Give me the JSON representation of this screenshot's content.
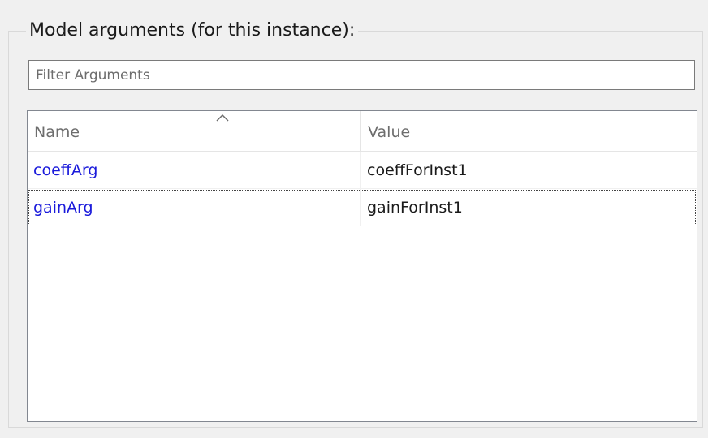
{
  "group": {
    "title": "Model arguments (for this instance):"
  },
  "filter": {
    "placeholder": "Filter Arguments",
    "value": ""
  },
  "table": {
    "columns": [
      "Name",
      "Value"
    ],
    "sort_icon": "chevron-up-icon",
    "rows": [
      {
        "name": "coeffArg",
        "value": "coeffForInst1"
      },
      {
        "name": "gainArg",
        "value": "gainForInst1"
      }
    ]
  },
  "colors": {
    "name_link": "#1a1adb",
    "panel_bg": "#f0f0f0",
    "table_bg": "#ffffff"
  }
}
